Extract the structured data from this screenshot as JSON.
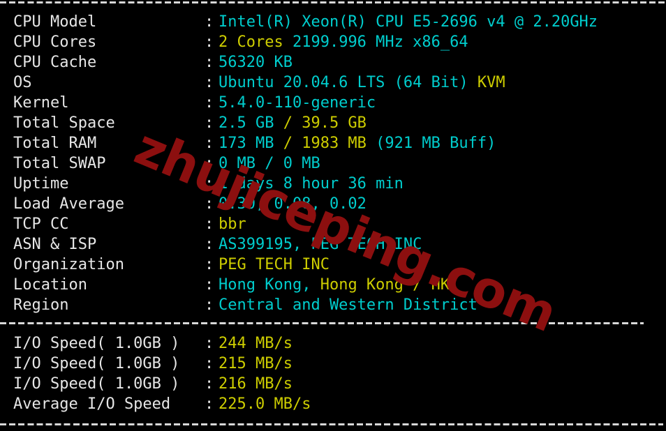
{
  "terminal": {
    "background": "#000000",
    "divider_top": "------------------------------------------------------------------------",
    "divider_middle": "------------------------------------------------------------------------",
    "divider_bottom": "------------------------------------------------------------------------",
    "colon": ":"
  },
  "watermark": {
    "text": "zhujiceping.com",
    "color": "#8c0f0f"
  },
  "colors": {
    "label": "#e6e6e6",
    "cyan": "#00cdcd",
    "yellow": "#cdcd00",
    "divider": "#d8d8d8"
  },
  "system_info": [
    {
      "label": "CPU Model",
      "value": "Intel(R) Xeon(R) CPU E5-2696 v4 @ 2.20GHz",
      "segments": [
        {
          "text": "Intel(R) Xeon(R) CPU E5-2696 v4 @ 2.20GHz",
          "color": "cyan"
        }
      ]
    },
    {
      "label": "CPU Cores",
      "value": "2 Cores 2199.996 MHz x86_64",
      "segments": [
        {
          "text": "2 Cores ",
          "color": "yellow"
        },
        {
          "text": "2199.996 MHz x86_64",
          "color": "cyan"
        }
      ]
    },
    {
      "label": "CPU Cache",
      "value": "56320 KB",
      "segments": [
        {
          "text": "56320 KB",
          "color": "cyan"
        }
      ]
    },
    {
      "label": "OS",
      "value": "Ubuntu 20.04.6 LTS (64 Bit) KVM",
      "segments": [
        {
          "text": "Ubuntu 20.04.6 LTS (64 Bit) ",
          "color": "cyan"
        },
        {
          "text": "KVM",
          "color": "yellow"
        }
      ]
    },
    {
      "label": "Kernel",
      "value": "5.4.0-110-generic",
      "segments": [
        {
          "text": "5.4.0-110-generic",
          "color": "cyan"
        }
      ]
    },
    {
      "label": "Total Space",
      "value": "2.5 GB / 39.5 GB",
      "segments": [
        {
          "text": "2.5 GB ",
          "color": "cyan"
        },
        {
          "text": "/ 39.5 GB",
          "color": "yellow"
        }
      ]
    },
    {
      "label": "Total RAM",
      "value": "173 MB / 1983 MB (921 MB Buff)",
      "segments": [
        {
          "text": "173 MB ",
          "color": "cyan"
        },
        {
          "text": "/ 1983 MB ",
          "color": "yellow"
        },
        {
          "text": "(921 MB Buff)",
          "color": "cyan"
        }
      ]
    },
    {
      "label": "Total SWAP",
      "value": "0 MB / 0 MB",
      "segments": [
        {
          "text": "0 MB / 0 MB",
          "color": "cyan"
        }
      ]
    },
    {
      "label": "Uptime",
      "value": "1 days 8 hour 36 min",
      "segments": [
        {
          "text": "1 days 8 hour 36 min",
          "color": "cyan"
        }
      ]
    },
    {
      "label": "Load Average",
      "value": "0.30, 0.08, 0.02",
      "segments": [
        {
          "text": "0.30, 0.08, 0.02",
          "color": "cyan"
        }
      ]
    },
    {
      "label": "TCP CC",
      "value": "bbr",
      "segments": [
        {
          "text": "bbr",
          "color": "yellow"
        }
      ]
    },
    {
      "label": "ASN & ISP",
      "value": "AS399195, PEG TECH INC",
      "segments": [
        {
          "text": "AS399195, PEG TECH INC",
          "color": "cyan"
        }
      ]
    },
    {
      "label": "Organization",
      "value": "PEG TECH INC",
      "segments": [
        {
          "text": "PEG TECH INC",
          "color": "yellow"
        }
      ]
    },
    {
      "label": "Location",
      "value": "Hong Kong, Hong Kong / HK",
      "segments": [
        {
          "text": "Hong Kong, ",
          "color": "cyan"
        },
        {
          "text": "Hong Kong / HK",
          "color": "yellow"
        }
      ]
    },
    {
      "label": "Region",
      "value": "Central and Western District",
      "segments": [
        {
          "text": "Central and Western District",
          "color": "cyan"
        }
      ]
    }
  ],
  "io_results": [
    {
      "label": "I/O Speed( 1.0GB )",
      "value": "244 MB/s",
      "segments": [
        {
          "text": "244 MB/s",
          "color": "yellow"
        }
      ]
    },
    {
      "label": "I/O Speed( 1.0GB )",
      "value": "215 MB/s",
      "segments": [
        {
          "text": "215 MB/s",
          "color": "yellow"
        }
      ]
    },
    {
      "label": "I/O Speed( 1.0GB )",
      "value": "216 MB/s",
      "segments": [
        {
          "text": "216 MB/s",
          "color": "yellow"
        }
      ]
    },
    {
      "label": "Average I/O Speed",
      "value": "225.0 MB/s",
      "segments": [
        {
          "text": "225.0 MB/s",
          "color": "yellow"
        }
      ]
    }
  ]
}
